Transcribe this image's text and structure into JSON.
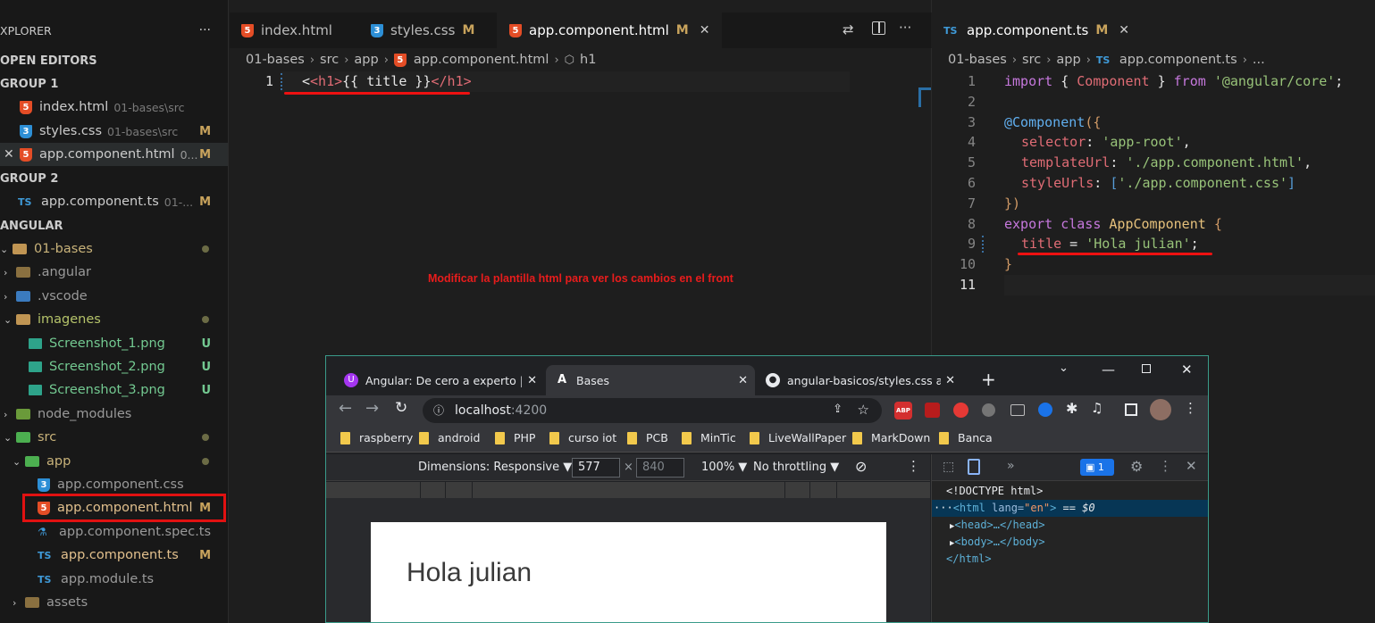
{
  "sidebar": {
    "explorer_label": "XPLORER",
    "more": "···",
    "open_editors": "OPEN EDITORS",
    "group1": "GROUP 1",
    "group1_items": [
      {
        "name": "index.html",
        "path": "01-bases\\src",
        "badge": ""
      },
      {
        "name": "styles.css",
        "path": "01-bases\\src",
        "badge": "M"
      },
      {
        "name": "app.component.html",
        "path": "0...",
        "badge": "M"
      }
    ],
    "group2": "GROUP 2",
    "group2_items": [
      {
        "name": "app.component.ts",
        "path": "01-...",
        "badge": "M"
      }
    ],
    "project": "ANGULAR",
    "tree": {
      "bases": "01-bases",
      "angular": ".angular",
      "vscode": ".vscode",
      "imagenes": "imagenes",
      "shot1": "Screenshot_1.png",
      "shot2": "Screenshot_2.png",
      "shot3": "Screenshot_3.png",
      "node_modules": "node_modules",
      "src": "src",
      "app": "app",
      "app_css": "app.component.css",
      "app_html": "app.component.html",
      "app_spec": "app.component.spec.ts",
      "app_ts": "app.component.ts",
      "app_module": "app.module.ts",
      "assets": "assets",
      "u": "U",
      "m": "M"
    }
  },
  "left_editor": {
    "tabs": [
      {
        "label": "index.html",
        "badge": ""
      },
      {
        "label": "styles.css",
        "badge": "M"
      },
      {
        "label": "app.component.html",
        "badge": "M"
      }
    ],
    "breadcrumb": [
      "01-bases",
      "src",
      "app",
      "app.component.html",
      "h1"
    ],
    "line_number": "1",
    "code_open": "<h1>",
    "code_interp": "{{ title }}",
    "code_close": "</h1>",
    "annotation": "Modificar la plantilla html para ver los cambios en el front"
  },
  "right_editor": {
    "tab": "app.component.ts",
    "tab_badge": "M",
    "breadcrumb": [
      "01-bases",
      "src",
      "app",
      "app.component.ts",
      "..."
    ],
    "line_numbers": [
      "1",
      "2",
      "3",
      "4",
      "5",
      "6",
      "7",
      "8",
      "9",
      "10",
      "11"
    ],
    "code": {
      "l1_import": "import",
      "l1_brace_open": " { ",
      "l1_component": "Component",
      "l1_brace_close": " } ",
      "l1_from": "from",
      "l1_module": "'@angular/core'",
      "l1_end": ";",
      "l3_decorator": "@Component",
      "l3_open": "({",
      "l4_key": "selector",
      "l4_val": "'app-root'",
      "l5_key": "templateUrl",
      "l5_val": "'./app.component.html'",
      "l6_key": "styleUrls",
      "l6_val": "'./app.component.css'",
      "l7_close": "})",
      "l8_export": "export",
      "l8_class": "class",
      "l8_name": "AppComponent",
      "l8_open": "{",
      "l9_key": "title",
      "l9_eq": " = ",
      "l9_val": "'Hola julian'",
      "l9_end": ";",
      "l10_close": "}"
    }
  },
  "browser": {
    "tabs": [
      {
        "label": "Angular: De cero a experto | Ude"
      },
      {
        "label": "Bases"
      },
      {
        "label": "angular-basicos/styles.css at ma"
      }
    ],
    "url_host": "localhost",
    "url_port": ":4200",
    "bookmarks": [
      "raspberry",
      "android",
      "PHP",
      "curso iot",
      "PCB",
      "MinTic",
      "LiveWallPaper",
      "MarkDown",
      "Banca"
    ],
    "device_toolbar": {
      "dimensions": "Dimensions: Responsive ▼",
      "width": "577",
      "times": "×",
      "height": "840",
      "zoom": "100% ▼",
      "throttle": "No throttling ▼"
    },
    "page_heading": "Hola julian",
    "devtools": {
      "issues": "1",
      "doctype": "<!DOCTYPE html>",
      "html_open_tag": "<html",
      "html_lang_attr": " lang=",
      "html_lang_val": "\"en\"",
      "html_close_bracket": ">",
      "eq": " == $0",
      "head": "<head>…</head>",
      "body": "<body>…</body>",
      "html_close": "</html>"
    }
  },
  "colors": {
    "accent_red": "#e11111",
    "vscode_bg": "#1e1e1e",
    "chrome_border": "#3a9b8a"
  }
}
